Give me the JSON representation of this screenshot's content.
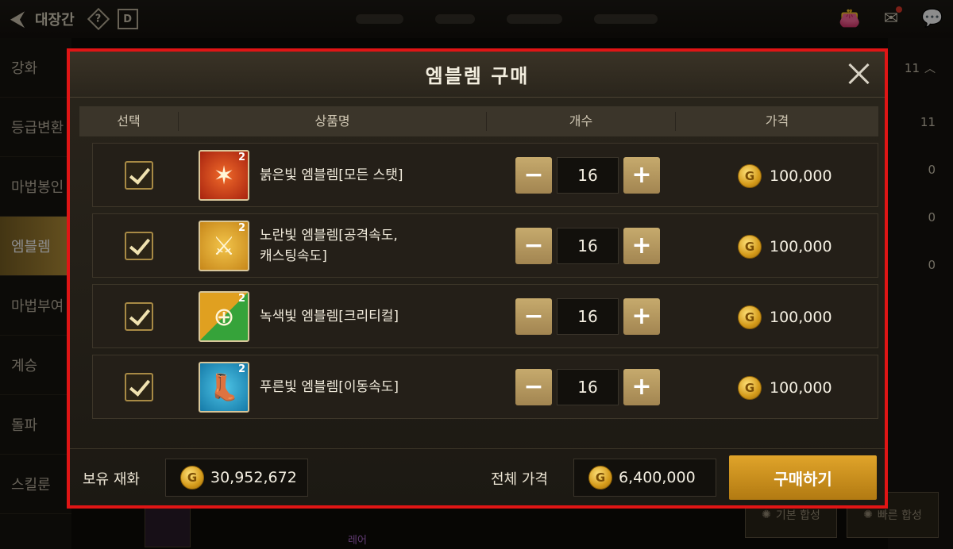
{
  "topbar": {
    "title": "대장간",
    "help_icon": "?",
    "d_icon": "D"
  },
  "sidemenu": {
    "items": [
      {
        "label": "강화"
      },
      {
        "label": "등급변환"
      },
      {
        "label": "마법봉인"
      },
      {
        "label": "엠블렘",
        "active": true
      },
      {
        "label": "마법부여"
      },
      {
        "label": "계승"
      },
      {
        "label": "돌파"
      },
      {
        "label": "스킬룬"
      }
    ]
  },
  "rightpanel": {
    "count_top": "11",
    "values": [
      "11",
      "0",
      "0",
      "0"
    ]
  },
  "background": {
    "basic_synth": "기본 합성",
    "quick_synth": "빠른 합성",
    "rare": "레어"
  },
  "modal": {
    "title": "엠블렘 구매",
    "columns": {
      "select": "선택",
      "product": "상품명",
      "count": "개수",
      "price": "가격"
    },
    "items": [
      {
        "name": "붉은빛 엠블렘[모든 스탯]",
        "qty": "16",
        "price": "100,000",
        "level": "2",
        "icon": "stat-icon"
      },
      {
        "name": "노란빛 엠블렘[공격속도, 캐스팅속도]",
        "qty": "16",
        "price": "100,000",
        "level": "2",
        "icon": "sword-icon"
      },
      {
        "name": "녹색빛 엠블렘[크리티컬]",
        "qty": "16",
        "price": "100,000",
        "level": "2",
        "icon": "crosshair-icon"
      },
      {
        "name": "푸른빛 엠블렘[이동속도]",
        "qty": "16",
        "price": "100,000",
        "level": "2",
        "icon": "boot-icon"
      }
    ],
    "coin_symbol": "G",
    "footer": {
      "owned_label": "보유 재화",
      "owned_value": "30,952,672",
      "total_label": "전체 가격",
      "total_value": "6,400,000",
      "buy_label": "구매하기"
    }
  },
  "colors": {
    "highlight_border": "#e01515",
    "gold": "#d49a1a",
    "buy_button": "#e0a42a"
  }
}
